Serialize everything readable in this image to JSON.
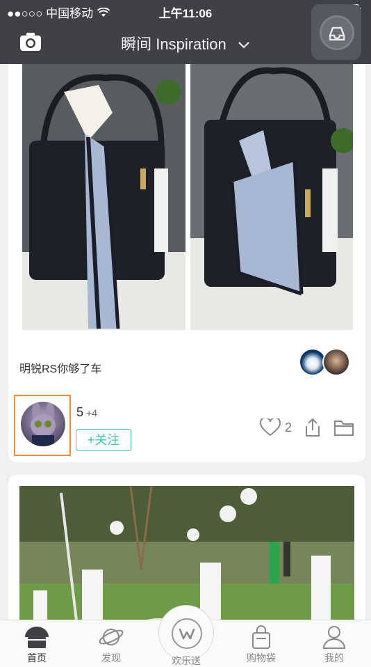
{
  "status_bar": {
    "carrier": "●●○○○ 中国移动",
    "time": "上午11:06"
  },
  "header": {
    "title": "瞬间 Inspiration",
    "camera_icon": "camera-icon",
    "dropdown_icon": "chevron-down-icon",
    "float_icon": "inbox-tray-icon"
  },
  "post1": {
    "caption": "明锐RS你够了车",
    "follower_count": "5",
    "follower_extra": "+4",
    "follow_label": "+关注",
    "like_count": "2"
  },
  "tabs": [
    {
      "label": "首页",
      "icon": "home-icon"
    },
    {
      "label": "发现",
      "icon": "planet-icon"
    },
    {
      "label": "欢乐送",
      "icon": "w-logo-icon"
    },
    {
      "label": "购物袋",
      "icon": "shopping-bag-icon"
    },
    {
      "label": "我的",
      "icon": "user-icon"
    }
  ],
  "colors": {
    "header_bg": "#3f4147",
    "accent": "#3bc3b3",
    "highlight": "#f08b3a"
  }
}
